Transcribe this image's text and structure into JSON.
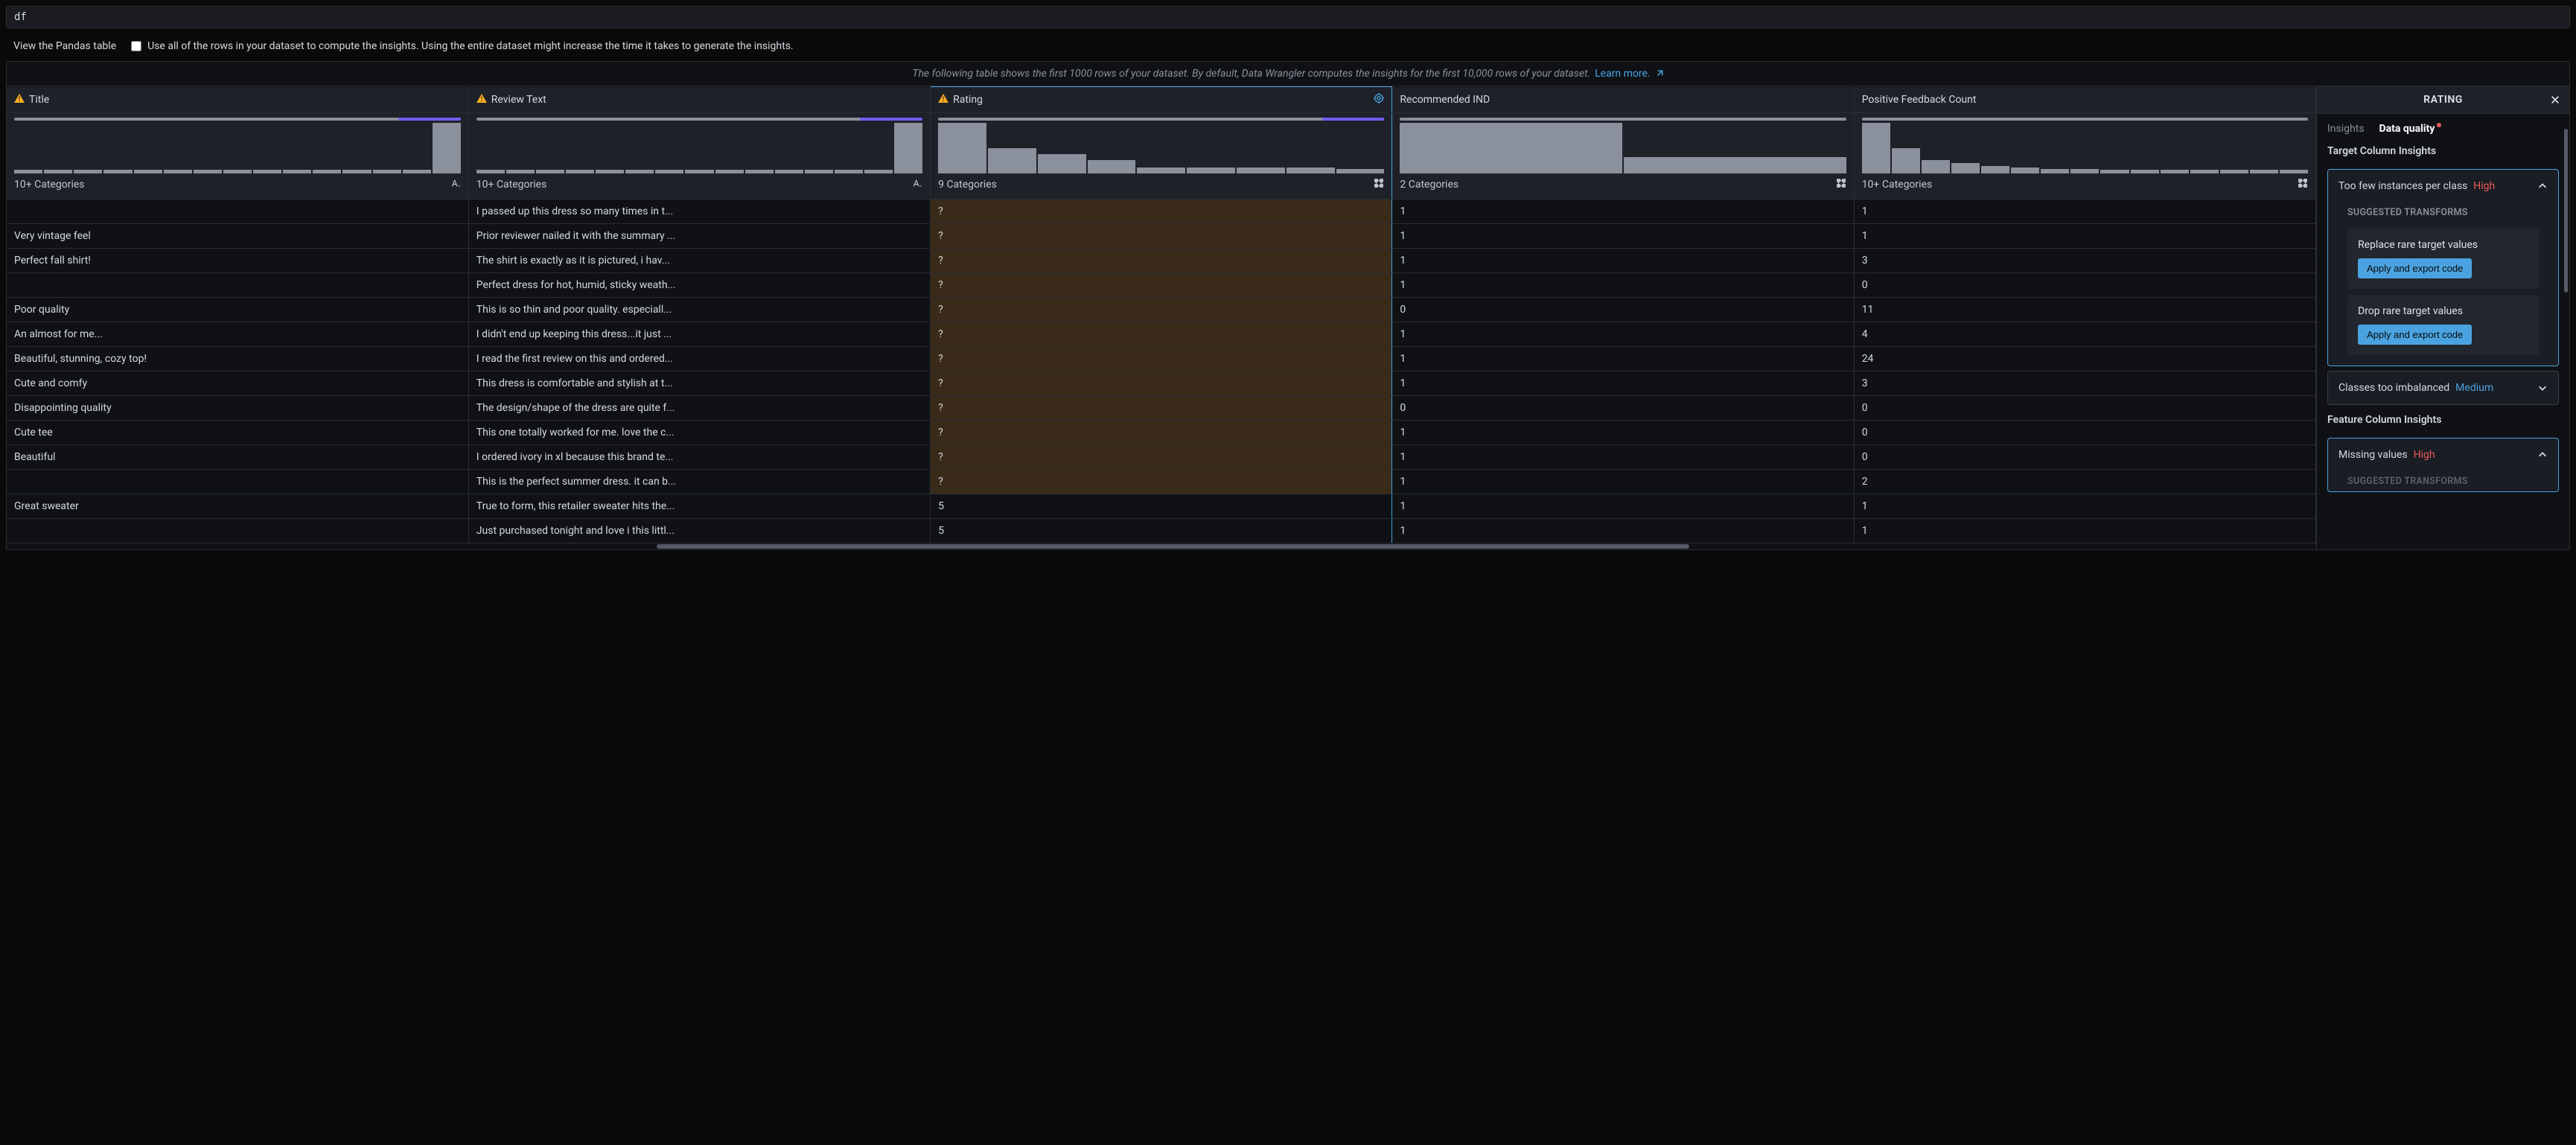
{
  "code_input": "df",
  "options": {
    "view_pandas_label": "View the Pandas table",
    "use_all_rows_label": "Use all of the rows in your dataset to compute the insights. Using the entire dataset might increase the time it takes to generate the insights."
  },
  "info_bar": {
    "text": "The following table shows the first 1000 rows of your dataset. By default, Data Wrangler computes the insights for the first 10,000 rows of your dataset.",
    "link_text": "Learn more."
  },
  "columns": [
    {
      "name": "Title",
      "warn": true,
      "categories": "10+ Categories",
      "type_icon": "text",
      "hist": [
        5,
        5,
        5,
        5,
        5,
        5,
        5,
        5,
        5,
        5,
        5,
        5,
        5,
        5,
        68
      ]
    },
    {
      "name": "Review Text",
      "warn": true,
      "categories": "10+ Categories",
      "type_icon": "text",
      "hist": [
        5,
        5,
        5,
        5,
        5,
        5,
        5,
        5,
        5,
        5,
        5,
        5,
        5,
        5,
        68
      ]
    },
    {
      "name": "Rating",
      "warn": true,
      "categories": "9 Categories",
      "type_icon": "categorical",
      "target": true,
      "hist": [
        68,
        34,
        26,
        18,
        8,
        8,
        8,
        8,
        6
      ]
    },
    {
      "name": "Recommended IND",
      "warn": false,
      "categories": "2 Categories",
      "type_icon": "categorical",
      "hist": [
        68,
        22
      ]
    },
    {
      "name": "Positive Feedback Count",
      "warn": false,
      "categories": "10+ Categories",
      "type_icon": "categorical",
      "hist": [
        68,
        34,
        18,
        14,
        10,
        8,
        6,
        6,
        5,
        5,
        5,
        5,
        5,
        5,
        5
      ]
    }
  ],
  "rows": [
    {
      "title": "",
      "review": "I passed up this dress so many times in t...",
      "rating": "?",
      "recommended": "1",
      "feedback": "1"
    },
    {
      "title": "Very vintage feel",
      "review": "Prior reviewer nailed it with the summary ...",
      "rating": "?",
      "recommended": "1",
      "feedback": "1"
    },
    {
      "title": "Perfect fall shirt!",
      "review": "The shirt is exactly as it is pictured, i hav...",
      "rating": "?",
      "recommended": "1",
      "feedback": "3"
    },
    {
      "title": "",
      "review": "Perfect dress for hot, humid, sticky weath...",
      "rating": "?",
      "recommended": "1",
      "feedback": "0"
    },
    {
      "title": "Poor quality",
      "review": "This is so thin and poor quality. especiall...",
      "rating": "?",
      "recommended": "0",
      "feedback": "11"
    },
    {
      "title": "An almost for me...",
      "review": "I didn't end up keeping this dress...it just ...",
      "rating": "?",
      "recommended": "1",
      "feedback": "4"
    },
    {
      "title": "Beautiful, stunning, cozy top!",
      "review": "I read the first review on this and ordered...",
      "rating": "?",
      "recommended": "1",
      "feedback": "24"
    },
    {
      "title": "Cute and comfy",
      "review": "This dress is comfortable and stylish at t...",
      "rating": "?",
      "recommended": "1",
      "feedback": "3"
    },
    {
      "title": "Disappointing quality",
      "review": "The design/shape of the dress are quite f...",
      "rating": "?",
      "recommended": "0",
      "feedback": "0"
    },
    {
      "title": "Cute tee",
      "review": "This one totally worked for me. love the c...",
      "rating": "?",
      "recommended": "1",
      "feedback": "0"
    },
    {
      "title": "Beautiful",
      "review": "I ordered ivory in xl because this brand te...",
      "rating": "?",
      "recommended": "1",
      "feedback": "0"
    },
    {
      "title": "",
      "review": "This is the perfect summer dress. it can b...",
      "rating": "?",
      "recommended": "1",
      "feedback": "2"
    },
    {
      "title": "Great sweater",
      "review": "True to form, this retailer sweater hits the...",
      "rating": "5",
      "recommended": "1",
      "feedback": "1"
    },
    {
      "title": "",
      "review": "Just purchased tonight and love i this littl...",
      "rating": "5",
      "recommended": "1",
      "feedback": "1"
    }
  ],
  "side": {
    "title": "RATING",
    "tabs": {
      "insights": "Insights",
      "data_quality": "Data quality"
    },
    "section_target": "Target Column Insights",
    "section_feature": "Feature Column Insights",
    "suggested_label": "SUGGESTED TRANSFORMS",
    "cards": {
      "too_few": {
        "title": "Too few instances per class",
        "severity": "High"
      },
      "imbalanced": {
        "title": "Classes too imbalanced",
        "severity": "Medium"
      },
      "missing": {
        "title": "Missing values",
        "severity": "High"
      }
    },
    "transforms": {
      "replace": "Replace rare target values",
      "drop": "Drop rare target values",
      "apply_btn": "Apply and export code"
    }
  }
}
